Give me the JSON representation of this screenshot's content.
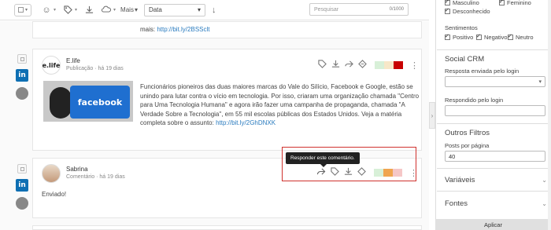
{
  "toolbar": {
    "more_label": "Mais",
    "date_select": "Data",
    "search_placeholder": "Pesquisar",
    "search_count": "0/1000"
  },
  "feed": {
    "prev_text": "mais: ",
    "prev_link": "http://bit.ly/2BSSclt",
    "post1": {
      "author": "E.life",
      "logo": "e.life",
      "meta": "Publicação · há 19 dias",
      "image_label": "facebook",
      "text": "Funcionários pioneiros das duas maiores marcas do Vale do Silício, Facebook e Google, estão se unindo para lutar contra o vício em tecnologia. Por isso, criaram uma organização chamada \"Centro para Uma Tecnologia Humana\" e agora irão fazer uma campanha de propaganda, chamada \"A Verdade Sobre a Tecnologia\", em 55 mil escolas públicas dos Estados Unidos. Veja a matéria completa sobre o assunto: ",
      "link": "http://bit.ly/2GhDNXK",
      "swatches": [
        "#d8f0d8",
        "#f7e7c8",
        "#c80000"
      ]
    },
    "post2": {
      "author": "Sabrina",
      "meta": "Comentário · há 19 dias",
      "text": "Enviado!",
      "tooltip": "Responder este comentário.",
      "swatches": [
        "#d8f0d8",
        "#f0a550",
        "#f5c7c7"
      ]
    }
  },
  "sidebar": {
    "gender": {
      "masculino": "Masculino",
      "feminino": "Feminino",
      "desconhecido": "Desconhecido"
    },
    "sentiments_title": "Sentimentos",
    "sentiments": {
      "positivo": "Positivo",
      "negativo": "Negativo",
      "neutro": "Neutro"
    },
    "social_crm_title": "Social CRM",
    "resposta_label": "Resposta enviada pelo login",
    "respondido_label": "Respondido pelo login",
    "outros_title": "Outros Filtros",
    "posts_por_pagina_label": "Posts por página",
    "posts_por_pagina_value": "40",
    "variaveis": "Variáveis",
    "fontes": "Fontes",
    "apply": "Aplicar"
  }
}
